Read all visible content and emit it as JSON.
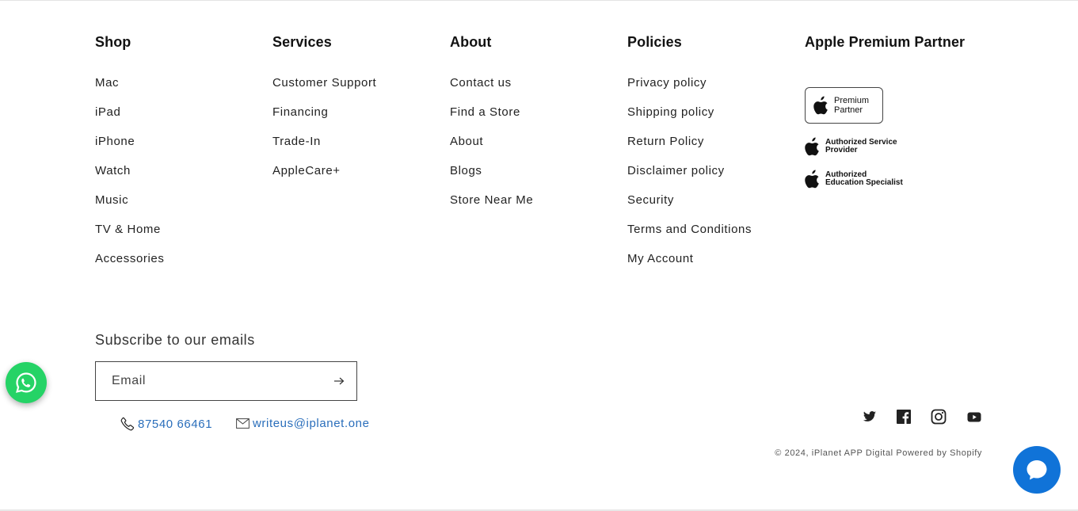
{
  "columns": {
    "shop": {
      "heading": "Shop",
      "links": [
        "Mac",
        "iPad",
        "iPhone",
        "Watch",
        "Music",
        "TV & Home",
        "Accessories"
      ]
    },
    "services": {
      "heading": "Services",
      "links": [
        "Customer Support",
        "Financing",
        "Trade-In",
        "AppleCare+"
      ]
    },
    "about": {
      "heading": "About",
      "links": [
        "Contact us",
        "Find a Store",
        "About",
        "Blogs",
        "Store Near Me"
      ]
    },
    "policies": {
      "heading": "Policies",
      "links": [
        "Privacy policy",
        "Shipping policy",
        "Return Policy",
        "Disclaimer policy",
        "Security",
        "Terms and Conditions",
        "My Account"
      ]
    },
    "partner": {
      "heading": "Apple Premium Partner",
      "badges": {
        "premium_line1": "Premium",
        "premium_line2": "Partner",
        "service_line1": "Authorized Service",
        "service_line2": "Provider",
        "education_line1": "Authorized",
        "education_line2": "Education Specialist"
      }
    }
  },
  "subscribe": {
    "heading": "Subscribe to our emails",
    "placeholder": "Email"
  },
  "contact": {
    "phone": "87540 66461",
    "email": "writeus@iplanet.one"
  },
  "social": [
    "twitter-icon",
    "facebook-icon",
    "instagram-icon",
    "youtube-icon"
  ],
  "copyright": {
    "prefix": "© 2024, ",
    "store": "iPlanet APP Digital",
    "powered": "Powered by Shopify"
  },
  "colors": {
    "link_blue": "#2a6ebb",
    "whatsapp_green": "#25d366",
    "chat_blue": "#1073d8"
  }
}
